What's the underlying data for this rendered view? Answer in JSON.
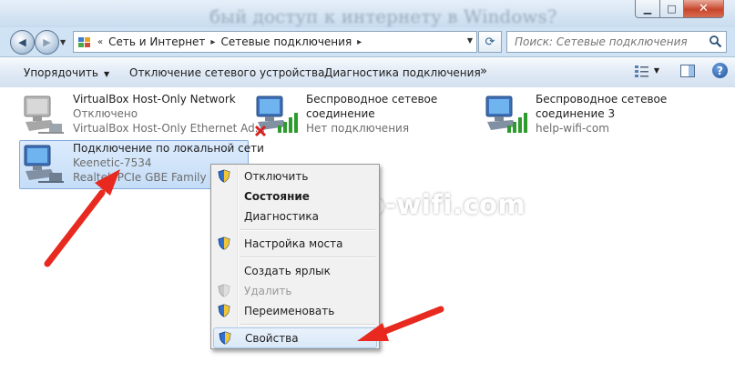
{
  "window": {
    "blurred_title": "бый доступ к интернету в Windows?",
    "caption": {
      "minimize_glyph": "▁",
      "maximize_glyph": "□",
      "close_glyph": "✕"
    }
  },
  "nav": {
    "back_glyph": "◀",
    "forward_glyph": "▶",
    "breadcrumb": [
      "Сеть и Интернет",
      "Сетевые подключения"
    ],
    "crumb_separator": "▸",
    "lead_separator": "«",
    "refresh_glyph": "⟳",
    "search_placeholder": "Поиск: Сетевые подключения"
  },
  "toolbar": {
    "organize": "Упорядочить",
    "disable_device": "Отключение сетевого устройства",
    "diagnose": "Диагностика подключения",
    "more": "»"
  },
  "connections": [
    {
      "name": "VirtualBox Host-Only Network",
      "status": "Отключено",
      "device": "VirtualBox Host-Only Ethernet Ad..."
    },
    {
      "name": "Беспроводное сетевое",
      "name2": "соединение",
      "status": "Нет подключения"
    },
    {
      "name": "Беспроводное сетевое",
      "name2": "соединение 3",
      "status": "help-wifi-com"
    },
    {
      "name": "Подключение по локальной сети",
      "status": "Keenetic-7534",
      "device": "Realtek PCIe GBE Family Cont..."
    }
  ],
  "context_menu": {
    "items": [
      {
        "label": "Отключить",
        "shield": true
      },
      {
        "label": "Состояние",
        "bold": true
      },
      {
        "label": "Диагностика"
      },
      {
        "label": "Настройка моста",
        "shield": true
      },
      {
        "label": "Создать ярлык"
      },
      {
        "label": "Удалить",
        "shield": true,
        "disabled": true
      },
      {
        "label": "Переименовать",
        "shield": true
      },
      {
        "label": "Свойства",
        "shield": true,
        "highlighted": true
      }
    ]
  },
  "watermark": "help-wifi.com",
  "colors": {
    "arrow": "#e8291f",
    "selection": "#c5ddf7",
    "signal_green": "#2e9b2e",
    "error_red": "#d42020"
  }
}
